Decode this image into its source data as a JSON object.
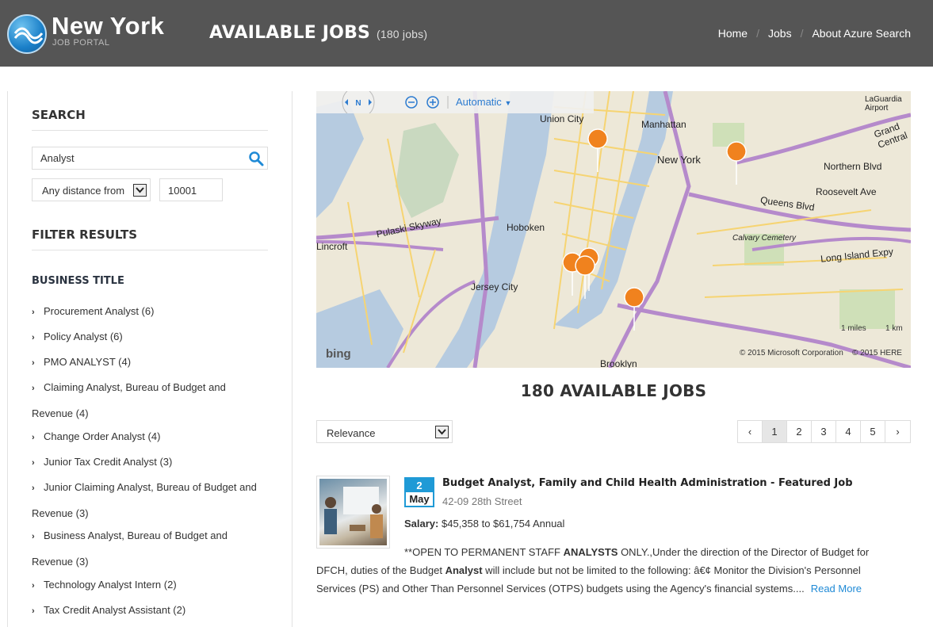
{
  "header": {
    "logo_title": "New York",
    "logo_subtitle": "JOB PORTAL",
    "heading": "AVAILABLE JOBS",
    "heading_count": "(180 jobs)",
    "nav": [
      {
        "label": "Home"
      },
      {
        "label": "Jobs"
      },
      {
        "label": "About Azure Search"
      }
    ]
  },
  "sidebar": {
    "search_heading": "SEARCH",
    "search_value": "Analyst",
    "distance_selected": "Any distance from",
    "zip_value": "10001",
    "filter_heading": "FILTER RESULTS",
    "business_title_heading": "BUSINESS TITLE",
    "facets": [
      {
        "label": "Procurement Analyst (6)"
      },
      {
        "label": "Policy Analyst (6)"
      },
      {
        "label": "PMO ANALYST (4)"
      },
      {
        "line1": "Claiming Analyst, Bureau of Budget and",
        "line2": "Revenue (4)"
      },
      {
        "label": "Change Order Analyst (4)"
      },
      {
        "label": "Junior Tax Credit Analyst (3)"
      },
      {
        "line1": "Junior Claiming Analyst, Bureau of Budget and",
        "line2": "Revenue (3)"
      },
      {
        "line1": "Business Analyst, Bureau of Budget and",
        "line2": "Revenue (3)"
      },
      {
        "label": "Technology Analyst Intern (2)"
      },
      {
        "label": "Tax Credit Analyst Assistant (2)"
      }
    ]
  },
  "map": {
    "mode_label": "Automatic",
    "compass_label": "N",
    "labels": {
      "union_city": "Union City",
      "manhattan": "Manhattan",
      "new_york": "New York",
      "hoboken": "Hoboken",
      "jersey_city": "Jersey City",
      "lincroft": "Lincroft",
      "pulaski": "Pulaski Skyway",
      "queens_blvd": "Queens Blvd",
      "newtown_blvd": "Northern Blvd",
      "roosevelt": "Roosevelt Ave",
      "li_expy": "Long Island Expy",
      "brooklyn": "Brooklyn",
      "calvary": "Calvary Cemetery",
      "laguardia": "LaGuardia Airport",
      "grand_central": "Grand Central"
    },
    "scale_miles": "1 miles",
    "scale_km": "1 km",
    "brand": "bing",
    "copyright_ms": "© 2015 Microsoft Corporation",
    "copyright_here": "© 2015 HERE"
  },
  "results": {
    "count": "180",
    "title": "AVAILABLE JOBS",
    "sort_selected": "Relevance",
    "pages": [
      "‹",
      "1",
      "2",
      "3",
      "4",
      "5",
      "›"
    ],
    "active_page": "1"
  },
  "job": {
    "day": "2",
    "month": "May",
    "title": "Budget Analyst, Family and Child Health Administration",
    "featured": " - Featured Job",
    "address": "42-09 28th Street",
    "salary_label": "Salary:",
    "salary_value": "$45,358 to $61,754 Annual",
    "desc_a": "**OPEN TO PERMANENT STAFF ",
    "desc_b": "ANALYSTS",
    "desc_c": " ONLY.,Under the direction of the Director of Budget for DFCH, duties of the Budget ",
    "desc_d": "Analyst",
    "desc_e": " will include but not be limited to the following: â€¢ Monitor the Division's Personnel Services (PS) and Other Than Personnel Services (OTPS) budgets using the Agency's financial systems....",
    "read_more": "Read More"
  },
  "colors": {
    "header_bg": "#555555",
    "accent_blue": "#1f9ad6",
    "link_blue": "#1f8ad6",
    "pin_orange": "#f0821e"
  }
}
